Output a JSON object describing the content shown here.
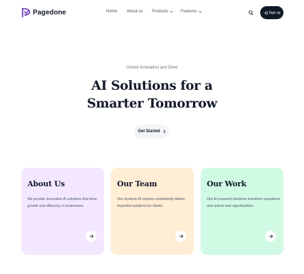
{
  "brand": {
    "name": "Pagedone",
    "accent": "#5b21b6"
  },
  "nav": {
    "items": [
      {
        "label": "Home",
        "has_dropdown": false
      },
      {
        "label": "About us",
        "has_dropdown": false
      },
      {
        "label": "Products",
        "has_dropdown": true
      },
      {
        "label": "Features",
        "has_dropdown": true
      }
    ],
    "search_icon": "search-icon",
    "signup_label": "Sign up"
  },
  "hero": {
    "subtitle": "Unlock Innovation and Drive",
    "title": "AI Solutions for a Smarter Tomorrow",
    "cta_label": "Get Started"
  },
  "cards": [
    {
      "title": "About Us",
      "text": "We provide innovative AI solutions that drive growth and efficiency in businesses.",
      "bg": "#f3e8ff"
    },
    {
      "title": "Our Team",
      "text": "Our dynamic AI experts consistently deliver impactful solutions for clients.",
      "bg": "#ffedd5"
    },
    {
      "title": "Our Work",
      "text": "Our AI-powered solutions transform operations and unlock new opportunities.",
      "bg": "#d1fae5"
    }
  ]
}
